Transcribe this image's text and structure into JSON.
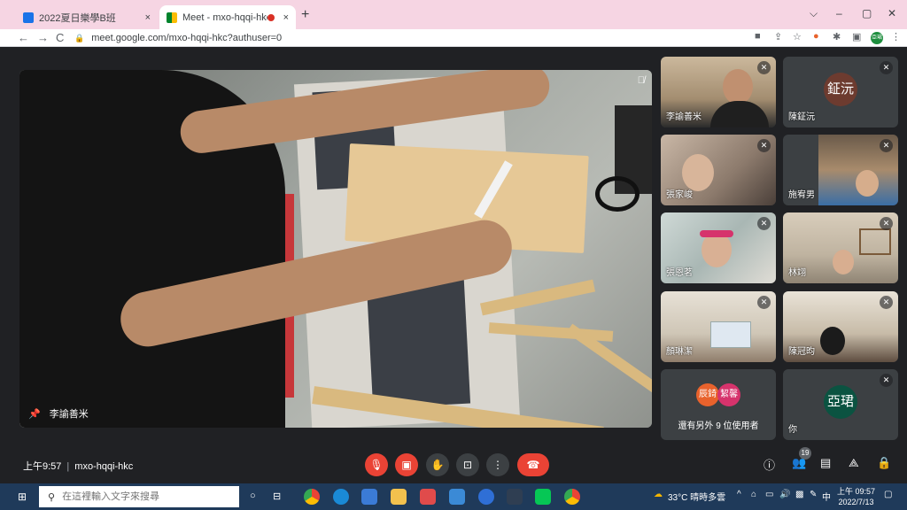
{
  "browser": {
    "tabs": [
      {
        "title": "2022夏日樂學B班",
        "close": "×"
      },
      {
        "title": "Meet - mxo-hqqi-hkc",
        "close": "×"
      }
    ],
    "new_tab": "+",
    "window_controls": [
      "⌵",
      "–",
      "▢",
      "✕"
    ],
    "nav": {
      "back": "←",
      "forward": "→",
      "reload": "C"
    },
    "url": "meet.google.com/mxo-hqqi-hkc?authuser=0",
    "profile_initials": "亞珺"
  },
  "meet": {
    "main_speaker": "李諭善米",
    "tiles": [
      {
        "name": "李諭善米",
        "muted": true
      },
      {
        "name": "陳鉦沅",
        "muted": true,
        "initials": "鉦沅",
        "color": "#6d3b2f"
      },
      {
        "name": "張家峻",
        "muted": true
      },
      {
        "name": "施宥男",
        "muted": true
      },
      {
        "name": "張恩茗",
        "muted": true
      },
      {
        "name": "林翊",
        "muted": true
      },
      {
        "name": "顏琳潔",
        "muted": true
      },
      {
        "name": "陳冠昀",
        "muted": true
      },
      {
        "name": "你",
        "muted": true,
        "initials": "亞珺",
        "color": "#0b5341"
      }
    ],
    "others": {
      "avatars": [
        {
          "initials": "辰錡",
          "color": "#e8622c"
        },
        {
          "initials": "絜馨",
          "color": "#d6336c"
        }
      ],
      "text": "還有另外 9 位使用者"
    },
    "time": "上午9:57",
    "meeting_code": "mxo-hqqi-hkc",
    "participants_count": "19",
    "icons": {
      "mic_off": "mic-off-icon",
      "cam_off": "video-off-icon",
      "hand": "raise-hand-icon",
      "present": "present-screen-icon",
      "more": "more-vert-icon",
      "leave": "call-end-icon"
    },
    "colors": {
      "danger": "#ea4335",
      "dark": "#202124",
      "tile": "#3c4043"
    }
  },
  "taskbar": {
    "search_placeholder": "在這裡輸入文字來搜尋",
    "weather": "33°C 晴時多雲",
    "ime": "中",
    "clock_time": "上午 09:57",
    "clock_date": "2022/7/13"
  }
}
